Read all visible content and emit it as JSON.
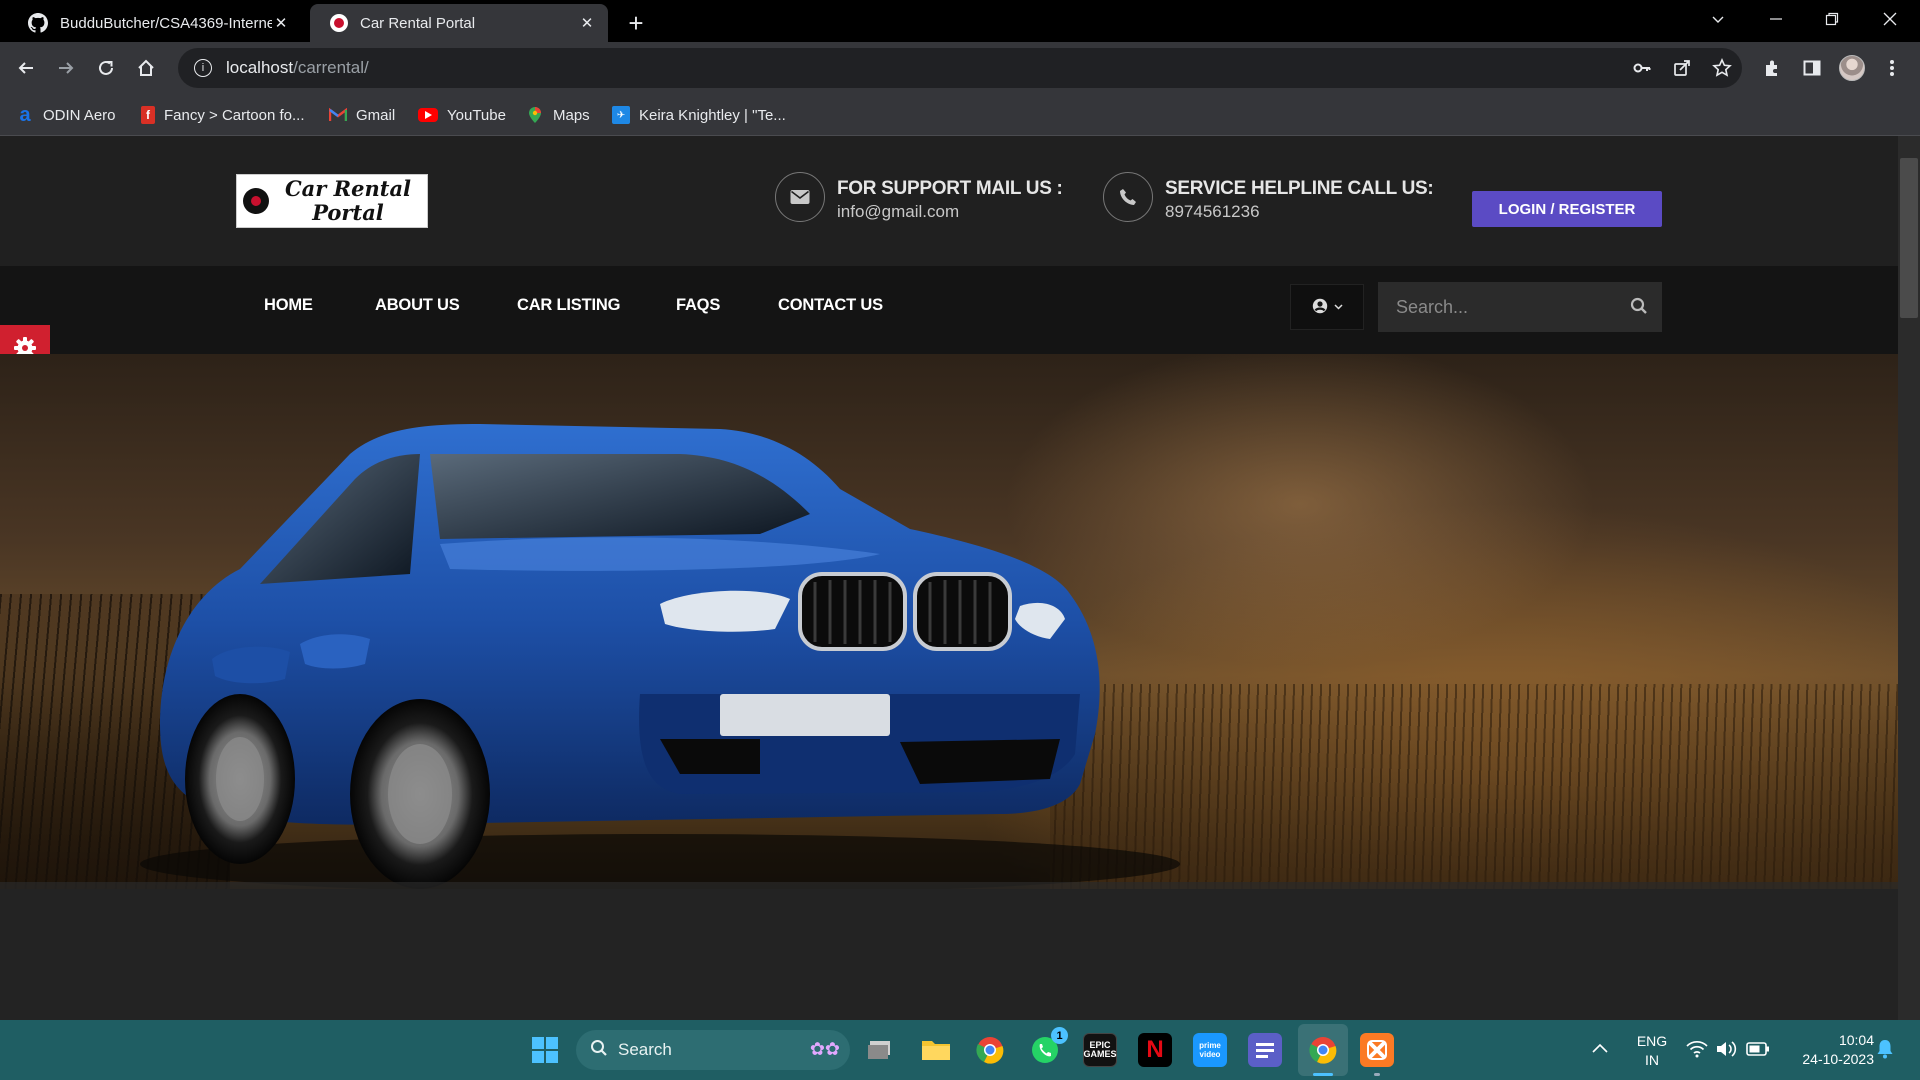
{
  "browser": {
    "tabs": [
      {
        "title": "BudduButcher/CSA4369-Interne",
        "icon": "github-icon",
        "active": false
      },
      {
        "title": "Car Rental Portal",
        "icon": "car-rental-favicon",
        "active": true
      }
    ],
    "new_tab_label": "+",
    "url": {
      "host": "localhost",
      "path": "/carrental/"
    },
    "bookmarks": [
      {
        "label": "ODIN Aero",
        "icon": "odin-icon",
        "color": "#1a73e8"
      },
      {
        "label": "Fancy > Cartoon fo...",
        "icon": "fancy-icon",
        "color": "#d93025"
      },
      {
        "label": "Gmail",
        "icon": "gmail-icon",
        "color": "#ea4335"
      },
      {
        "label": "YouTube",
        "icon": "youtube-icon",
        "color": "#ff0000"
      },
      {
        "label": "Maps",
        "icon": "maps-icon",
        "color": "#34a853"
      },
      {
        "label": "Keira Knightley | \"Te...",
        "icon": "bookmark-site-icon",
        "color": "#1e88e5"
      }
    ]
  },
  "site": {
    "logo_line1": "Car Rental",
    "logo_line2": "Portal",
    "support": {
      "title": "FOR SUPPORT MAIL US :",
      "value": "info@gmail.com"
    },
    "helpline": {
      "title": "SERVICE HELPLINE CALL US:",
      "value": "8974561236"
    },
    "login_label": "LOGIN / REGISTER",
    "nav": [
      "HOME",
      "ABOUT US",
      "CAR LISTING",
      "FAQS",
      "CONTACT US"
    ],
    "search_placeholder": "Search...",
    "accent_color": "#5b4bc4",
    "settings_color": "#d0202f"
  },
  "taskbar": {
    "search_label": "Search",
    "lang_line1": "ENG",
    "lang_line2": "IN",
    "time": "10:04",
    "date": "24-10-2023",
    "whatsapp_badge": "1",
    "apps": [
      "windows-start-icon",
      "search-icon",
      "task-view-icon",
      "file-explorer-icon",
      "chrome-icon",
      "whatsapp-icon",
      "epic-games-icon",
      "netflix-icon",
      "prime-video-icon",
      "notes-app-icon",
      "chrome-active-icon",
      "xampp-icon"
    ]
  }
}
